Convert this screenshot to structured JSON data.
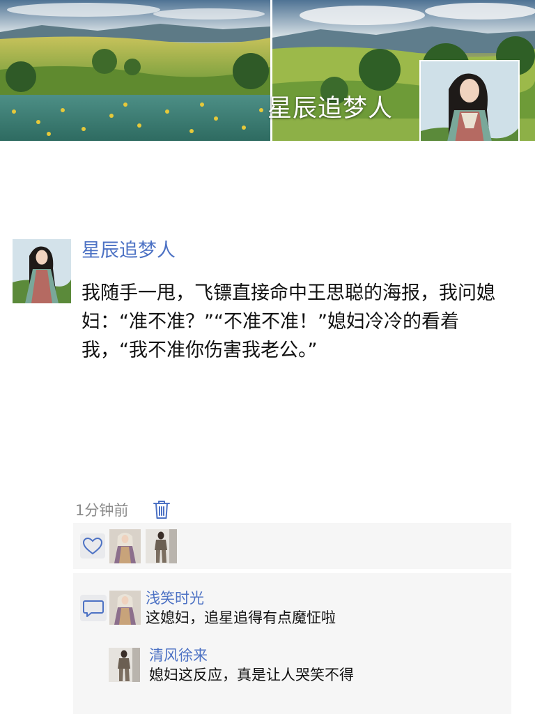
{
  "cover": {
    "name": "星辰追梦人",
    "avatar_icon": "profile-portrait-icon"
  },
  "post": {
    "author": "星辰追梦人",
    "text": "我随手一甩，飞镖直接命中王思聪的海报，我问媳妇：“准不准？”“不准不准！”媳妇冷冷的看着我，“我不准你伤害我老公。”",
    "time": "1分钟前",
    "delete_icon": "trash-icon"
  },
  "likes": {
    "icon": "heart-outline-icon",
    "avatars": [
      "liker-avatar-1",
      "liker-avatar-2"
    ]
  },
  "comments": {
    "icon": "comment-bubble-icon",
    "items": [
      {
        "author": "浅笑时光",
        "text": "这媳妇，追星追得有点魔怔啦"
      },
      {
        "author": "清风徐来",
        "text": "媳妇这反应，真是让人哭笑不得"
      }
    ]
  },
  "colors": {
    "link_blue": "#4d72c4",
    "panel_bg": "#f6f6f6",
    "secondary_text": "#8a8a8a",
    "icon_blue": "#4d72c4"
  }
}
